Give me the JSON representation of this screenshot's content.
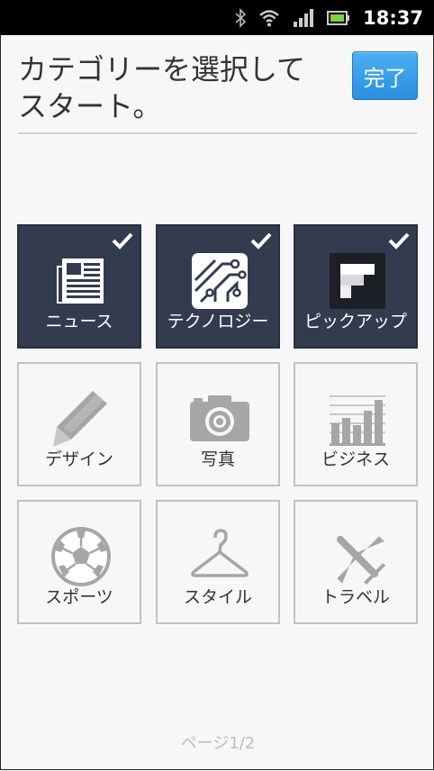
{
  "status_bar": {
    "time": "18:37",
    "icons": [
      "bluetooth-icon",
      "wifi-icon",
      "signal-icon",
      "battery-icon"
    ]
  },
  "header": {
    "title": "カテゴリーを選択してスタート。",
    "done_label": "完了"
  },
  "categories": [
    {
      "label": "ニュース",
      "icon": "newspaper-icon",
      "selected": true
    },
    {
      "label": "テクノロジー",
      "icon": "circuit-board-icon",
      "selected": true
    },
    {
      "label": "ピックアップ",
      "icon": "flipboard-logo-icon",
      "selected": true
    },
    {
      "label": "デザイン",
      "icon": "pencil-icon",
      "selected": false
    },
    {
      "label": "写真",
      "icon": "camera-icon",
      "selected": false
    },
    {
      "label": "ビジネス",
      "icon": "bar-chart-icon",
      "selected": false
    },
    {
      "label": "スポーツ",
      "icon": "soccer-ball-icon",
      "selected": false
    },
    {
      "label": "スタイル",
      "icon": "hanger-icon",
      "selected": false
    },
    {
      "label": "トラベル",
      "icon": "airplane-icon",
      "selected": false
    }
  ],
  "colors": {
    "selected_tile": "#323c4e",
    "unselected_border": "#c2c2c2",
    "done_button": "#2b8ee0",
    "icon_gray": "#a6a6a6"
  },
  "footer": {
    "page_indicator": "ページ1/2"
  }
}
